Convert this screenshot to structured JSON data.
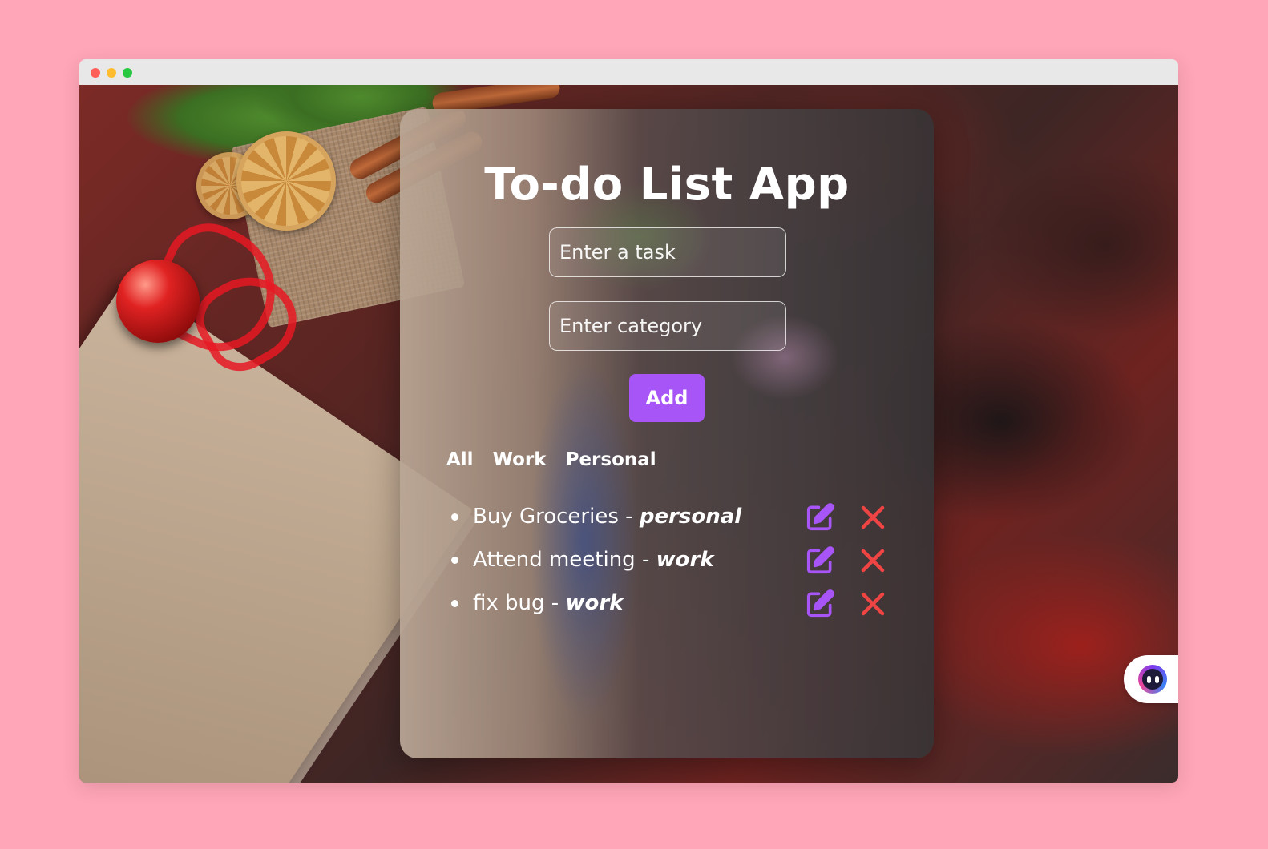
{
  "app": {
    "title": "To-do List App"
  },
  "form": {
    "task_placeholder": "Enter a task",
    "category_placeholder": "Enter category",
    "add_label": "Add"
  },
  "filters": [
    "All",
    "Work",
    "Personal"
  ],
  "tasks": [
    {
      "name": "Buy Groceries",
      "separator": " - ",
      "category": "personal"
    },
    {
      "name": "Attend meeting",
      "separator": " - ",
      "category": "work"
    },
    {
      "name": "fix bug",
      "separator": " - ",
      "category": "work"
    }
  ],
  "icons": {
    "edit": "edit-icon",
    "delete": "close-icon",
    "chat": "chat-assistant-icon"
  },
  "colors": {
    "page_background": "#ffa6b8",
    "accent": "#a855f7",
    "delete": "#ef4444"
  }
}
